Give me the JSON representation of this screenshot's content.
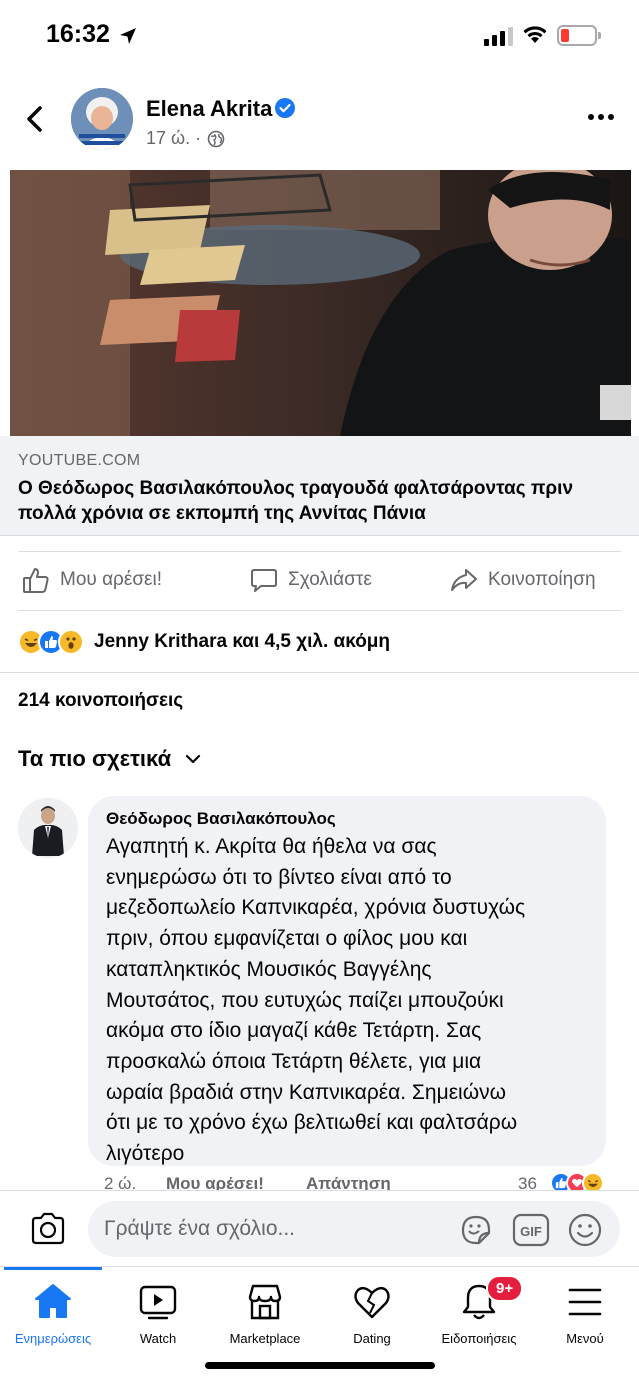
{
  "status_bar": {
    "time": "16:32"
  },
  "post": {
    "author": "Elena Akrita",
    "meta": "17 ώ. ·",
    "link": {
      "domain": "YOUTUBE.COM",
      "title": "Ο Θεόδωρος Βασιλακόπουλος τραγουδά φαλτσάροντας πριν πολλά χρόνια σε εκπομπή της Αννίτας Πάνια"
    },
    "actions": {
      "like": "Μου αρέσει!",
      "comment": "Σχολιάστε",
      "share": "Κοινοποίηση"
    },
    "reactions_text": "Jenny Krithara και 4,5 χιλ. ακόμη",
    "shares": "214 κοινοποιήσεις",
    "sort_label": "Τα πιο σχετικά"
  },
  "comment": {
    "author": "Θεόδωρος Βασιλακόπουλος",
    "text": "Αγαπητή κ. Ακρίτα θα ήθελα να σας\nενημερώσω ότι το βίντεο είναι από  το\nμεζεδοπωλείο Καπνικαρέα, χρόνια δυστυχώς\nπριν, όπου εμφανίζεται ο φίλος μου και\nκαταπληκτικός Μουσικός Βαγγέλης\nΜουτσάτος, που ευτυχώς παίζει μπουζούκι\nακόμα στο ίδιο μαγαζί κάθε Τετάρτη. Σας\nπροσκαλώ όποια Τετάρτη θέλετε, για μια\nωραία βραδιά στην Καπνικαρέα.    Σημειώνω\nότι με το χρόνο έχω βελτιωθεί και φαλτσάρω\nλιγότερο",
    "time": "2 ώ.",
    "like": "Μου αρέσει!",
    "reply": "Απάντηση",
    "reaction_count": "36"
  },
  "composer": {
    "placeholder": "Γράψτε ένα σχόλιο..."
  },
  "tabs": [
    {
      "label": "Ενημερώσεις",
      "icon": "home-icon",
      "active": true
    },
    {
      "label": "Watch",
      "icon": "watch-icon"
    },
    {
      "label": "Marketplace",
      "icon": "marketplace-icon"
    },
    {
      "label": "Dating",
      "icon": "dating-icon"
    },
    {
      "label": "Ειδοποιήσεις",
      "icon": "bell-icon",
      "badge": "9+"
    },
    {
      "label": "Μενού",
      "icon": "menu-icon"
    }
  ],
  "colors": {
    "accent": "#1877f2",
    "badge": "#e41e3f",
    "secondary_text": "#65676b",
    "surface": "#f0f2f5"
  }
}
